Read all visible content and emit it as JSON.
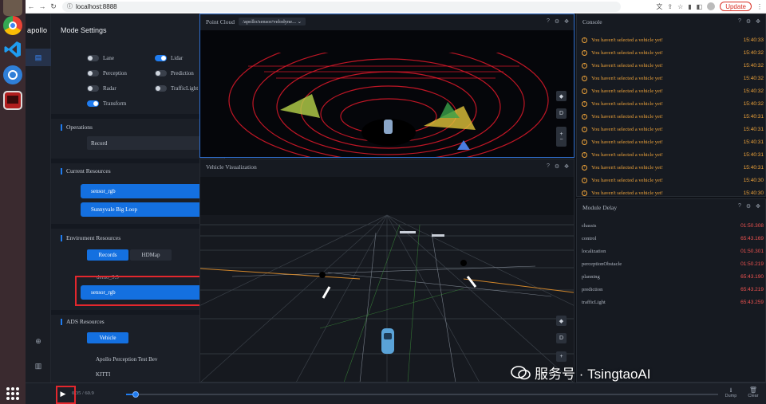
{
  "browser": {
    "url": "localhost:8888",
    "update_label": "Update"
  },
  "nav": {
    "logo_text": "apollo"
  },
  "mode_settings": {
    "title": "Mode Settings",
    "layers": [
      {
        "label": "Lane",
        "on": false
      },
      {
        "label": "Lidar",
        "on": true
      },
      {
        "label": "Perception",
        "on": false
      },
      {
        "label": "Prediction",
        "on": false
      },
      {
        "label": "Radar",
        "on": false
      },
      {
        "label": "TrafficLight",
        "on": false
      },
      {
        "label": "Transform",
        "on": true
      }
    ],
    "operations": {
      "title": "Operations",
      "value": "Record"
    },
    "current_resources": {
      "title": "Current Resources",
      "items": [
        "sensor_rgb",
        "Sunnyvale Big Loop"
      ]
    },
    "environment_resources": {
      "title": "Enviroment Resources",
      "tabs": [
        "Records",
        "HDMap"
      ],
      "items": [
        "demo_3.5",
        "sensor_rgb"
      ]
    },
    "ads_resources": {
      "title": "ADS Resources",
      "tab": "Vehicle",
      "items": [
        "Apollo Perception Test Bev",
        "KITTI"
      ]
    }
  },
  "point_cloud": {
    "title": "Point Cloud",
    "channel": "/apollo/sensor/velodyne...",
    "controls": [
      "D",
      "+",
      "−"
    ]
  },
  "vehicle_viz": {
    "title": "Vehicle Visualization",
    "controls": [
      "D",
      "+"
    ]
  },
  "console": {
    "title": "Console",
    "rows": [
      {
        "text": "You haven't selected a vehicle yet!",
        "time": "15:40:33"
      },
      {
        "text": "You haven't selected a vehicle yet!",
        "time": "15:40:32"
      },
      {
        "text": "You haven't selected a vehicle yet!",
        "time": "15:40:32"
      },
      {
        "text": "You haven't selected a vehicle yet!",
        "time": "15:40:32"
      },
      {
        "text": "You haven't selected a vehicle yet!",
        "time": "15:40:32"
      },
      {
        "text": "You haven't selected a vehicle yet!",
        "time": "15:40:32"
      },
      {
        "text": "You haven't selected a vehicle yet!",
        "time": "15:40:31"
      },
      {
        "text": "You haven't selected a vehicle yet!",
        "time": "15:40:31"
      },
      {
        "text": "You haven't selected a vehicle yet!",
        "time": "15:40:31"
      },
      {
        "text": "You haven't selected a vehicle yet!",
        "time": "15:40:31"
      },
      {
        "text": "You haven't selected a vehicle yet!",
        "time": "15:40:31"
      },
      {
        "text": "You haven't selected a vehicle yet!",
        "time": "15:40:30"
      },
      {
        "text": "You haven't selected a vehicle yet!",
        "time": "15:40:30"
      }
    ]
  },
  "module_delay": {
    "title": "Module Delay",
    "rows": [
      {
        "name": "chassis",
        "value": "01:50.308"
      },
      {
        "name": "control",
        "value": "65:43.169"
      },
      {
        "name": "localization",
        "value": "01:50.301"
      },
      {
        "name": "perceptionObstacle",
        "value": "01:50.219"
      },
      {
        "name": "planning",
        "value": "65:43.190"
      },
      {
        "name": "prediction",
        "value": "65:43.219"
      },
      {
        "name": "trafficLight",
        "value": "65:43.259"
      }
    ]
  },
  "playback": {
    "time": "0.35 / 60.9",
    "progress": 0.016,
    "dump_label": "Dump",
    "clear_label": "Clear"
  },
  "watermark": {
    "text": "服务号 · TsingtaoAI"
  },
  "colors": {
    "accent": "#1470e0",
    "warning": "#f0a43a",
    "delay": "#ef5350",
    "highlight_box": "#e3272d"
  }
}
